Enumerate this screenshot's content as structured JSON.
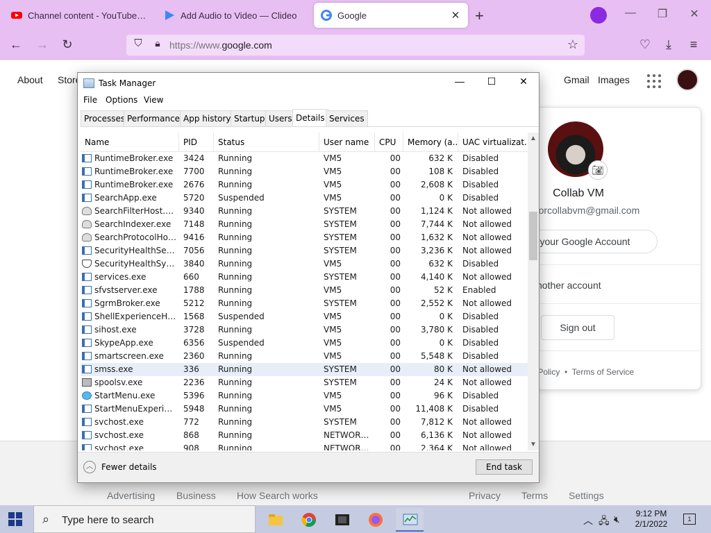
{
  "browser": {
    "tabs": [
      {
        "title": "Channel content - YouTube Studio",
        "favicon": "youtube-icon",
        "color": "#ff0000"
      },
      {
        "title": "Add Audio to Video — Clideo",
        "favicon": "clideo-play-icon",
        "color": "#3a86ff"
      },
      {
        "title": "Google",
        "favicon": "google-icon",
        "color": "#4285f4"
      }
    ],
    "new_tab": "+",
    "url_scheme": "https://www.",
    "url_host": "google.com",
    "accent": "#e8bff3"
  },
  "google": {
    "top_left_links": [
      "About",
      "Store"
    ],
    "top_right_links": [
      "Gmail",
      "Images"
    ],
    "account": {
      "name": "Collab VM",
      "email": "estforcollabvm@gmail.com",
      "manage": "ge your Google Account",
      "other": "nother account",
      "sign_out": "Sign out",
      "footer_privacy": "y Policy",
      "footer_dot": "•",
      "footer_terms": "Terms of Service"
    },
    "footer_links": [
      "Advertising",
      "Business",
      "How Search works",
      "Privacy",
      "Terms",
      "Settings"
    ]
  },
  "taskmanager": {
    "title": "Task Manager",
    "menu": [
      "File",
      "Options",
      "View"
    ],
    "tabs": [
      "Processes",
      "Performance",
      "App history",
      "Startup",
      "Users",
      "Details",
      "Services"
    ],
    "active_tab": "Details",
    "columns": [
      "Name",
      "PID",
      "Status",
      "User name",
      "CPU",
      "Memory (a...",
      "UAC virtualizat..."
    ],
    "rows": [
      {
        "name": "RuntimeBroker.exe",
        "pid": "3424",
        "status": "Running",
        "user": "VM5",
        "cpu": "00",
        "mem": "632 K",
        "uac": "Disabled",
        "icon": "app"
      },
      {
        "name": "RuntimeBroker.exe",
        "pid": "7700",
        "status": "Running",
        "user": "VM5",
        "cpu": "00",
        "mem": "108 K",
        "uac": "Disabled",
        "icon": "app"
      },
      {
        "name": "RuntimeBroker.exe",
        "pid": "2676",
        "status": "Running",
        "user": "VM5",
        "cpu": "00",
        "mem": "2,608 K",
        "uac": "Disabled",
        "icon": "app"
      },
      {
        "name": "SearchApp.exe",
        "pid": "5720",
        "status": "Suspended",
        "user": "VM5",
        "cpu": "00",
        "mem": "0 K",
        "uac": "Disabled",
        "icon": "app"
      },
      {
        "name": "SearchFilterHost.exe",
        "pid": "9340",
        "status": "Running",
        "user": "SYSTEM",
        "cpu": "00",
        "mem": "1,124 K",
        "uac": "Not allowed",
        "icon": "user"
      },
      {
        "name": "SearchIndexer.exe",
        "pid": "7148",
        "status": "Running",
        "user": "SYSTEM",
        "cpu": "00",
        "mem": "7,744 K",
        "uac": "Not allowed",
        "icon": "user"
      },
      {
        "name": "SearchProtocolHost....",
        "pid": "9416",
        "status": "Running",
        "user": "SYSTEM",
        "cpu": "00",
        "mem": "1,632 K",
        "uac": "Not allowed",
        "icon": "user"
      },
      {
        "name": "SecurityHealthServic...",
        "pid": "7056",
        "status": "Running",
        "user": "SYSTEM",
        "cpu": "00",
        "mem": "3,236 K",
        "uac": "Not allowed",
        "icon": "app"
      },
      {
        "name": "SecurityHealthSystra...",
        "pid": "3840",
        "status": "Running",
        "user": "VM5",
        "cpu": "00",
        "mem": "632 K",
        "uac": "Disabled",
        "icon": "shield"
      },
      {
        "name": "services.exe",
        "pid": "660",
        "status": "Running",
        "user": "SYSTEM",
        "cpu": "00",
        "mem": "4,140 K",
        "uac": "Not allowed",
        "icon": "app"
      },
      {
        "name": "sfvstserver.exe",
        "pid": "1788",
        "status": "Running",
        "user": "VM5",
        "cpu": "00",
        "mem": "52 K",
        "uac": "Enabled",
        "icon": "app"
      },
      {
        "name": "SgrmBroker.exe",
        "pid": "5212",
        "status": "Running",
        "user": "SYSTEM",
        "cpu": "00",
        "mem": "2,552 K",
        "uac": "Not allowed",
        "icon": "app"
      },
      {
        "name": "ShellExperienceHost....",
        "pid": "1568",
        "status": "Suspended",
        "user": "VM5",
        "cpu": "00",
        "mem": "0 K",
        "uac": "Disabled",
        "icon": "app"
      },
      {
        "name": "sihost.exe",
        "pid": "3728",
        "status": "Running",
        "user": "VM5",
        "cpu": "00",
        "mem": "3,780 K",
        "uac": "Disabled",
        "icon": "app"
      },
      {
        "name": "SkypeApp.exe",
        "pid": "6356",
        "status": "Suspended",
        "user": "VM5",
        "cpu": "00",
        "mem": "0 K",
        "uac": "Disabled",
        "icon": "app"
      },
      {
        "name": "smartscreen.exe",
        "pid": "2360",
        "status": "Running",
        "user": "VM5",
        "cpu": "00",
        "mem": "5,548 K",
        "uac": "Disabled",
        "icon": "app"
      },
      {
        "name": "smss.exe",
        "pid": "336",
        "status": "Running",
        "user": "SYSTEM",
        "cpu": "00",
        "mem": "80 K",
        "uac": "Not allowed",
        "icon": "app",
        "selected": true
      },
      {
        "name": "spoolsv.exe",
        "pid": "2236",
        "status": "Running",
        "user": "SYSTEM",
        "cpu": "00",
        "mem": "24 K",
        "uac": "Not allowed",
        "icon": "printer"
      },
      {
        "name": "StartMenu.exe",
        "pid": "5396",
        "status": "Running",
        "user": "VM5",
        "cpu": "00",
        "mem": "96 K",
        "uac": "Disabled",
        "icon": "globe"
      },
      {
        "name": "StartMenuExperienc...",
        "pid": "5948",
        "status": "Running",
        "user": "VM5",
        "cpu": "00",
        "mem": "11,408 K",
        "uac": "Disabled",
        "icon": "app"
      },
      {
        "name": "svchost.exe",
        "pid": "772",
        "status": "Running",
        "user": "SYSTEM",
        "cpu": "00",
        "mem": "7,812 K",
        "uac": "Not allowed",
        "icon": "app"
      },
      {
        "name": "svchost.exe",
        "pid": "868",
        "status": "Running",
        "user": "NETWORK...",
        "cpu": "00",
        "mem": "6,136 K",
        "uac": "Not allowed",
        "icon": "app"
      },
      {
        "name": "svchost.exe",
        "pid": "908",
        "status": "Running",
        "user": "NETWORK...",
        "cpu": "00",
        "mem": "2,364 K",
        "uac": "Not allowed",
        "icon": "app"
      }
    ],
    "fewer_details": "Fewer details",
    "end_task": "End task"
  },
  "taskbar": {
    "search_placeholder": "Type here to search",
    "apps": [
      "file-explorer-icon",
      "chrome-icon",
      "video-editor-icon",
      "firefox-icon",
      "task-manager-icon"
    ],
    "time": "9:12 PM",
    "date": "2/1/2022",
    "notifications": "1"
  }
}
